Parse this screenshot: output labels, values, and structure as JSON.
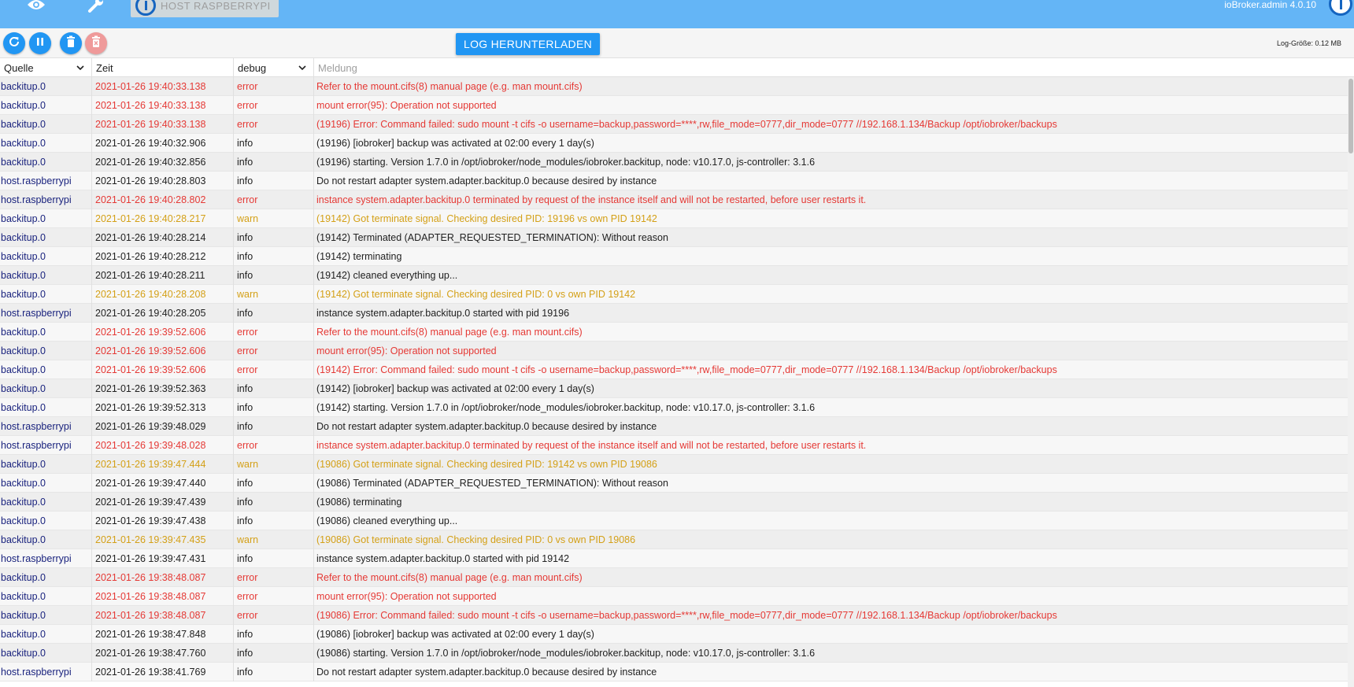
{
  "appbar": {
    "host_tab_label": "HOST RASPBERRYPI",
    "admin_version": "ioBroker.admin 4.0.10",
    "icons": [
      "eye-icon",
      "wrench-icon",
      "iobroker-logo"
    ]
  },
  "toolbar": {
    "buttons": [
      "refresh-icon",
      "pause-icon",
      "delete-icon",
      "delete-forever-icon"
    ],
    "download_label": "LOG HERUNTERLADEN",
    "log_size": "Log-Größe: 0.12 MB"
  },
  "table": {
    "headers": {
      "source": "Quelle",
      "time": "Zeit",
      "level": "debug",
      "message_placeholder": "Meldung"
    },
    "rows": [
      {
        "source": "backitup.0",
        "time": "2021-01-26 19:40:33.138",
        "level": "error",
        "message": "Refer to the mount.cifs(8) manual page (e.g. man mount.cifs)"
      },
      {
        "source": "backitup.0",
        "time": "2021-01-26 19:40:33.138",
        "level": "error",
        "message": "mount error(95): Operation not supported"
      },
      {
        "source": "backitup.0",
        "time": "2021-01-26 19:40:33.138",
        "level": "error",
        "message": "(19196) Error: Command failed: sudo mount -t cifs -o username=backup,password=****,rw,file_mode=0777,dir_mode=0777 //192.168.1.134/Backup /opt/iobroker/backups"
      },
      {
        "source": "backitup.0",
        "time": "2021-01-26 19:40:32.906",
        "level": "info",
        "message": "(19196) [iobroker] backup was activated at 02:00 every 1 day(s)"
      },
      {
        "source": "backitup.0",
        "time": "2021-01-26 19:40:32.856",
        "level": "info",
        "message": "(19196) starting. Version 1.7.0 in /opt/iobroker/node_modules/iobroker.backitup, node: v10.17.0, js-controller: 3.1.6"
      },
      {
        "source": "host.raspberrypi",
        "time": "2021-01-26 19:40:28.803",
        "level": "info",
        "message": "Do not restart adapter system.adapter.backitup.0 because desired by instance"
      },
      {
        "source": "host.raspberrypi",
        "time": "2021-01-26 19:40:28.802",
        "level": "error",
        "message": "instance system.adapter.backitup.0 terminated by request of the instance itself and will not be restarted, before user restarts it."
      },
      {
        "source": "backitup.0",
        "time": "2021-01-26 19:40:28.217",
        "level": "warn",
        "message": "(19142) Got terminate signal. Checking desired PID: 19196 vs own PID 19142"
      },
      {
        "source": "backitup.0",
        "time": "2021-01-26 19:40:28.214",
        "level": "info",
        "message": "(19142) Terminated (ADAPTER_REQUESTED_TERMINATION): Without reason"
      },
      {
        "source": "backitup.0",
        "time": "2021-01-26 19:40:28.212",
        "level": "info",
        "message": "(19142) terminating"
      },
      {
        "source": "backitup.0",
        "time": "2021-01-26 19:40:28.211",
        "level": "info",
        "message": "(19142) cleaned everything up..."
      },
      {
        "source": "backitup.0",
        "time": "2021-01-26 19:40:28.208",
        "level": "warn",
        "message": "(19142) Got terminate signal. Checking desired PID: 0 vs own PID 19142"
      },
      {
        "source": "host.raspberrypi",
        "time": "2021-01-26 19:40:28.205",
        "level": "info",
        "message": "instance system.adapter.backitup.0 started with pid 19196"
      },
      {
        "source": "backitup.0",
        "time": "2021-01-26 19:39:52.606",
        "level": "error",
        "message": "Refer to the mount.cifs(8) manual page (e.g. man mount.cifs)"
      },
      {
        "source": "backitup.0",
        "time": "2021-01-26 19:39:52.606",
        "level": "error",
        "message": "mount error(95): Operation not supported"
      },
      {
        "source": "backitup.0",
        "time": "2021-01-26 19:39:52.606",
        "level": "error",
        "message": "(19142) Error: Command failed: sudo mount -t cifs -o username=backup,password=****,rw,file_mode=0777,dir_mode=0777 //192.168.1.134/Backup /opt/iobroker/backups"
      },
      {
        "source": "backitup.0",
        "time": "2021-01-26 19:39:52.363",
        "level": "info",
        "message": "(19142) [iobroker] backup was activated at 02:00 every 1 day(s)"
      },
      {
        "source": "backitup.0",
        "time": "2021-01-26 19:39:52.313",
        "level": "info",
        "message": "(19142) starting. Version 1.7.0 in /opt/iobroker/node_modules/iobroker.backitup, node: v10.17.0, js-controller: 3.1.6"
      },
      {
        "source": "host.raspberrypi",
        "time": "2021-01-26 19:39:48.029",
        "level": "info",
        "message": "Do not restart adapter system.adapter.backitup.0 because desired by instance"
      },
      {
        "source": "host.raspberrypi",
        "time": "2021-01-26 19:39:48.028",
        "level": "error",
        "message": "instance system.adapter.backitup.0 terminated by request of the instance itself and will not be restarted, before user restarts it."
      },
      {
        "source": "backitup.0",
        "time": "2021-01-26 19:39:47.444",
        "level": "warn",
        "message": "(19086) Got terminate signal. Checking desired PID: 19142 vs own PID 19086"
      },
      {
        "source": "backitup.0",
        "time": "2021-01-26 19:39:47.440",
        "level": "info",
        "message": "(19086) Terminated (ADAPTER_REQUESTED_TERMINATION): Without reason"
      },
      {
        "source": "backitup.0",
        "time": "2021-01-26 19:39:47.439",
        "level": "info",
        "message": "(19086) terminating"
      },
      {
        "source": "backitup.0",
        "time": "2021-01-26 19:39:47.438",
        "level": "info",
        "message": "(19086) cleaned everything up..."
      },
      {
        "source": "backitup.0",
        "time": "2021-01-26 19:39:47.435",
        "level": "warn",
        "message": "(19086) Got terminate signal. Checking desired PID: 0 vs own PID 19086"
      },
      {
        "source": "host.raspberrypi",
        "time": "2021-01-26 19:39:47.431",
        "level": "info",
        "message": "instance system.adapter.backitup.0 started with pid 19142"
      },
      {
        "source": "backitup.0",
        "time": "2021-01-26 19:38:48.087",
        "level": "error",
        "message": "Refer to the mount.cifs(8) manual page (e.g. man mount.cifs)"
      },
      {
        "source": "backitup.0",
        "time": "2021-01-26 19:38:48.087",
        "level": "error",
        "message": "mount error(95): Operation not supported"
      },
      {
        "source": "backitup.0",
        "time": "2021-01-26 19:38:48.087",
        "level": "error",
        "message": "(19086) Error: Command failed: sudo mount -t cifs -o username=backup,password=****,rw,file_mode=0777,dir_mode=0777 //192.168.1.134/Backup /opt/iobroker/backups"
      },
      {
        "source": "backitup.0",
        "time": "2021-01-26 19:38:47.848",
        "level": "info",
        "message": "(19086) [iobroker] backup was activated at 02:00 every 1 day(s)"
      },
      {
        "source": "backitup.0",
        "time": "2021-01-26 19:38:47.760",
        "level": "info",
        "message": "(19086) starting. Version 1.7.0 in /opt/iobroker/node_modules/iobroker.backitup, node: v10.17.0, js-controller: 3.1.6"
      },
      {
        "source": "host.raspberrypi",
        "time": "2021-01-26 19:38:41.769",
        "level": "info",
        "message": "Do not restart adapter system.adapter.backitup.0 because desired by instance"
      }
    ]
  },
  "colors": {
    "appbar": "#64b5f6",
    "primary_button": "#2196f3",
    "error": "#e53935",
    "warn": "#d4a017",
    "info": "#212121",
    "source": "#1a237e"
  }
}
